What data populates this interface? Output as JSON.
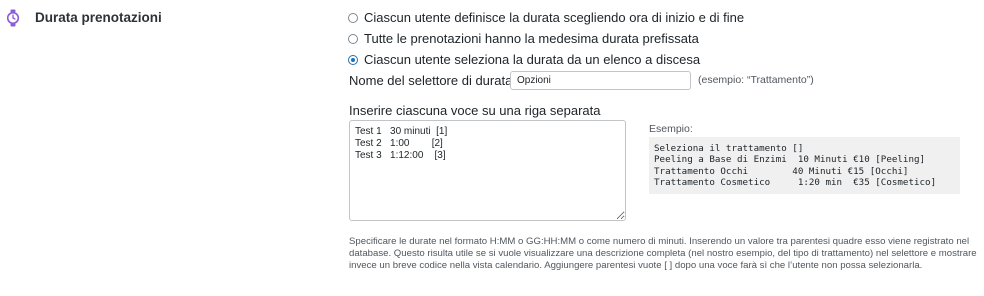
{
  "section": {
    "title": "Durata prenotazioni",
    "icon": "stopwatch-icon",
    "icon_color": "#8c5cd6"
  },
  "duration_options": [
    {
      "label": "Ciascun utente definisce la durata scegliendo ora di inizio e di fine",
      "checked": false
    },
    {
      "label": "Tutte le prenotazioni hanno la medesima durata prefissata",
      "checked": false
    },
    {
      "label": "Ciascun utente seleziona la durata da un elenco a discesa",
      "checked": true
    }
  ],
  "selector": {
    "label": "Nome del selettore di durata:",
    "value": "Opzioni",
    "example": "(esempio: “Trattamento”)"
  },
  "items": {
    "label": "Inserire ciascuna voce su una riga separata",
    "value": "Test 1   30 minuti  [1]\nTest 2   1:00        [2]\nTest 3   1:12:00    [3]"
  },
  "example": {
    "label": "Esempio:",
    "code": "Seleziona il trattamento []\nPeeling a Base di Enzimi  10 Minuti €10 [Peeling]\nTrattamento Occhi        40 Minuti €15 [Occhi]\nTrattamento Cosmetico     1:20 min  €35 [Cosmetico]"
  },
  "help_text": "Specificare le durate nel formato H:MM o GG:HH:MM o come numero di minuti. Inserendo un valore tra parentesi quadre esso viene registrato nel database. Questo risulta utile se si vuole visualizzare una descrizione completa (nel nostro esempio, del tipo di trattamento) nel selettore e mostrare invece un breve codice nella vista calendario. Aggiungere parentesi vuote [ ] dopo una voce farà sì che l’utente non possa selezionarla.",
  "colors": {
    "accent": "#2271b1",
    "border": "#c3c4c7",
    "example_bg": "#f0f0f1"
  }
}
